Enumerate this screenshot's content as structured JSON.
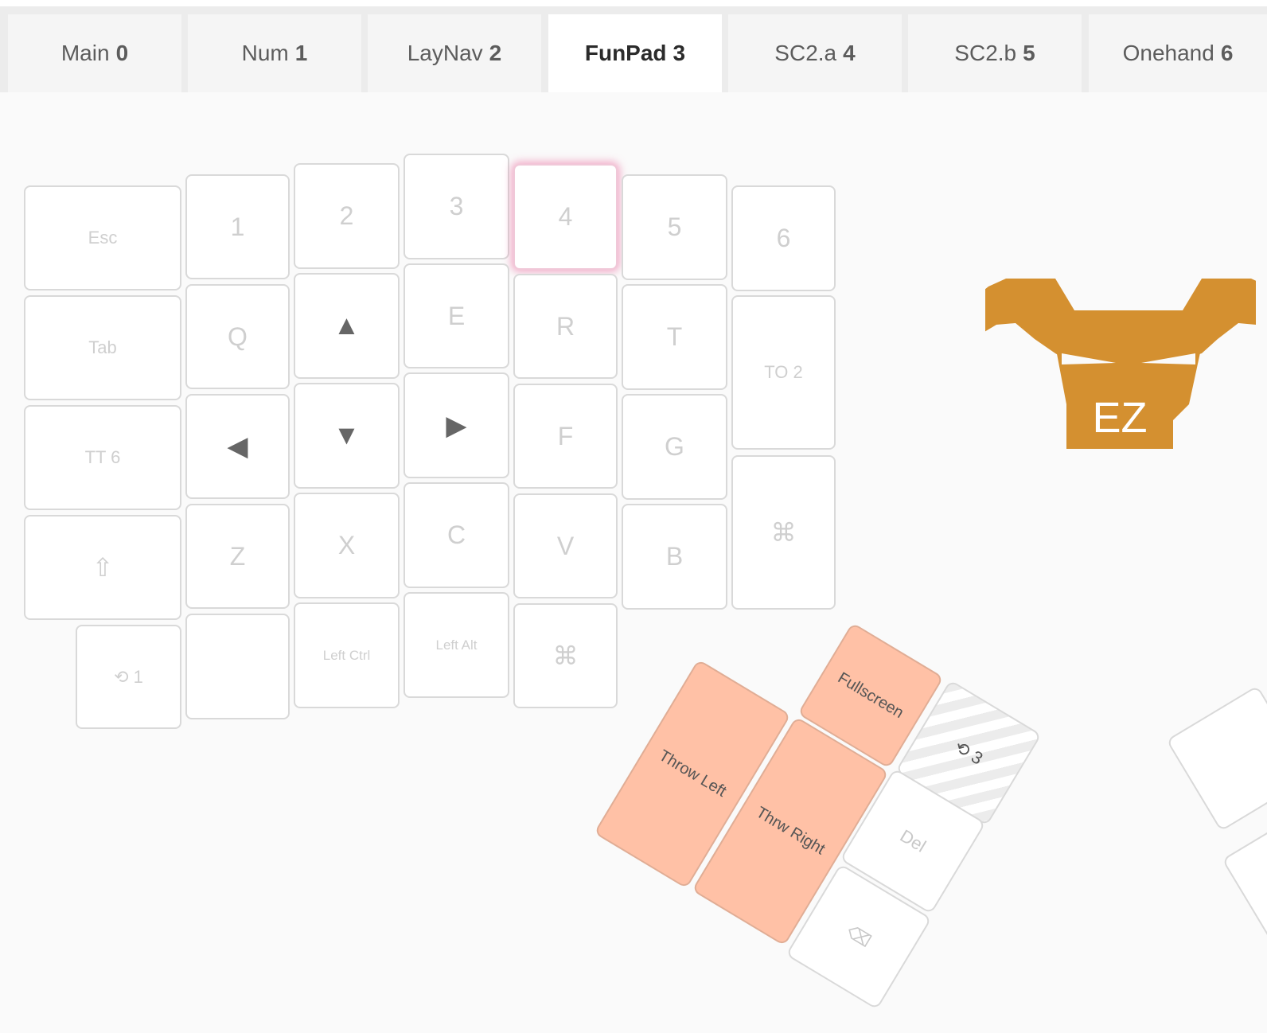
{
  "tabs": [
    {
      "name": "Main",
      "num": "0"
    },
    {
      "name": "Num",
      "num": "1"
    },
    {
      "name": "LayNav",
      "num": "2"
    },
    {
      "name": "FunPad",
      "num": "3"
    },
    {
      "name": "SC2.a",
      "num": "4"
    },
    {
      "name": "SC2.b",
      "num": "5"
    },
    {
      "name": "Onehand",
      "num": "6"
    }
  ],
  "active_tab": "FunPad",
  "keys": {
    "esc": "Esc",
    "k1": "1",
    "k2": "2",
    "k3": "3",
    "k4": "4",
    "k5": "5",
    "k6": "6",
    "tab": "Tab",
    "q": "Q",
    "e": "E",
    "r": "R",
    "t": "T",
    "to2": "TO 2",
    "tt6": "TT 6",
    "f": "F",
    "g": "G",
    "z": "Z",
    "x": "X",
    "c": "C",
    "v": "V",
    "b": "B",
    "cmd": "⌘",
    "shift": "⇧",
    "osl1": "⟲ 1",
    "left_ctrl": "Left Ctrl",
    "left_alt": "Left Alt",
    "cmd2": "⌘",
    "up": "▲",
    "left": "◀",
    "down": "▼",
    "right": "▶"
  },
  "thumb_keys": {
    "fullscreen": "Fullscreen",
    "throw_left": "Throw Left",
    "throw_right": "Thrw Right",
    "osl3": "⟲ 3",
    "del": "Del",
    "backspace": "⌫"
  },
  "logo": {
    "badge": "EZ"
  },
  "colors": {
    "accent": "#d49030",
    "function_key": "#ffc1a6",
    "active_glow": "#eb6ea0"
  }
}
